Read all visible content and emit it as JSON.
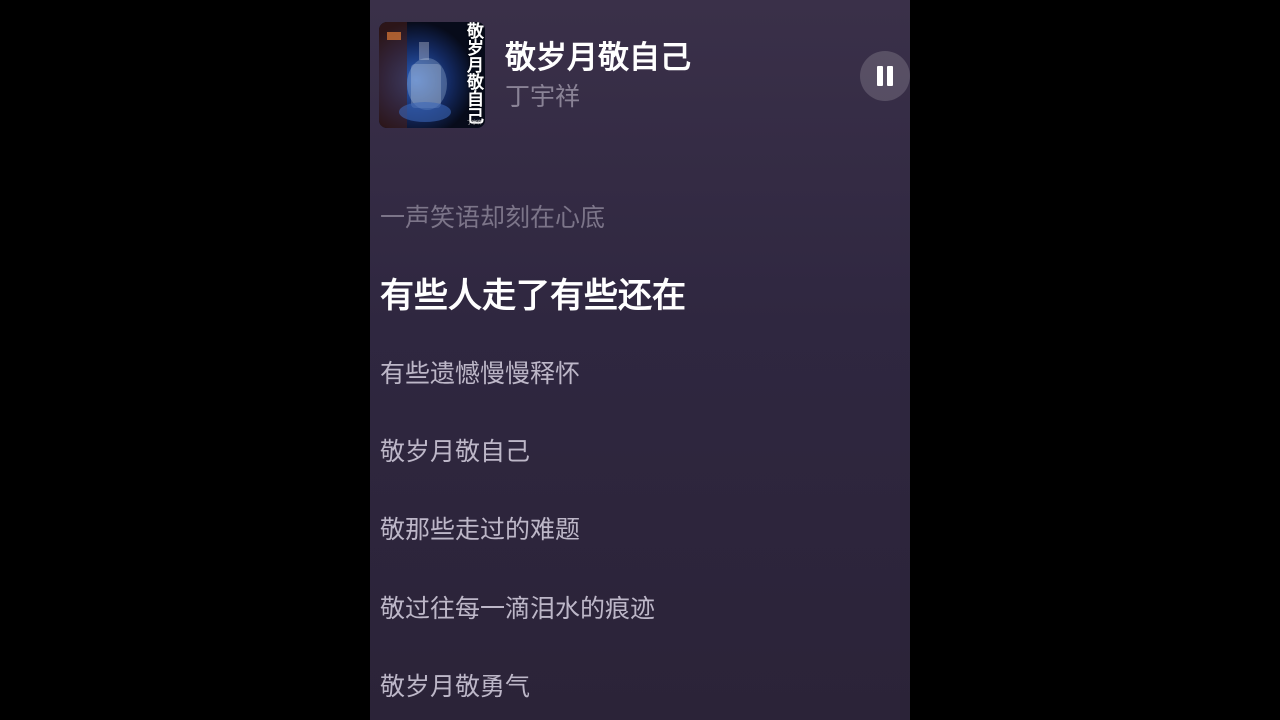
{
  "colors": {
    "page_background": "#000000",
    "player_background": "#342b43",
    "active_lyric": "#ffffff",
    "upcoming_lyric": "#bdb7c8",
    "past_lyric": "#7c7589",
    "artist_text": "#8a8396"
  },
  "player": {
    "cover": {
      "icon": "album-cover",
      "text": "敬岁月敬自己",
      "credit": "丁宇祥"
    },
    "title": "敬岁月敬自己",
    "artist": "丁宇祥",
    "control": {
      "icon": "pause-icon",
      "state": "playing"
    }
  },
  "lyrics": {
    "past": "一声笑语却刻在心底",
    "active": "有些人走了有些还在",
    "upcoming": [
      "有些遗憾慢慢释怀",
      "敬岁月敬自己",
      "敬那些走过的难题",
      "敬过往每一滴泪水的痕迹",
      "敬岁月敬勇气"
    ]
  }
}
